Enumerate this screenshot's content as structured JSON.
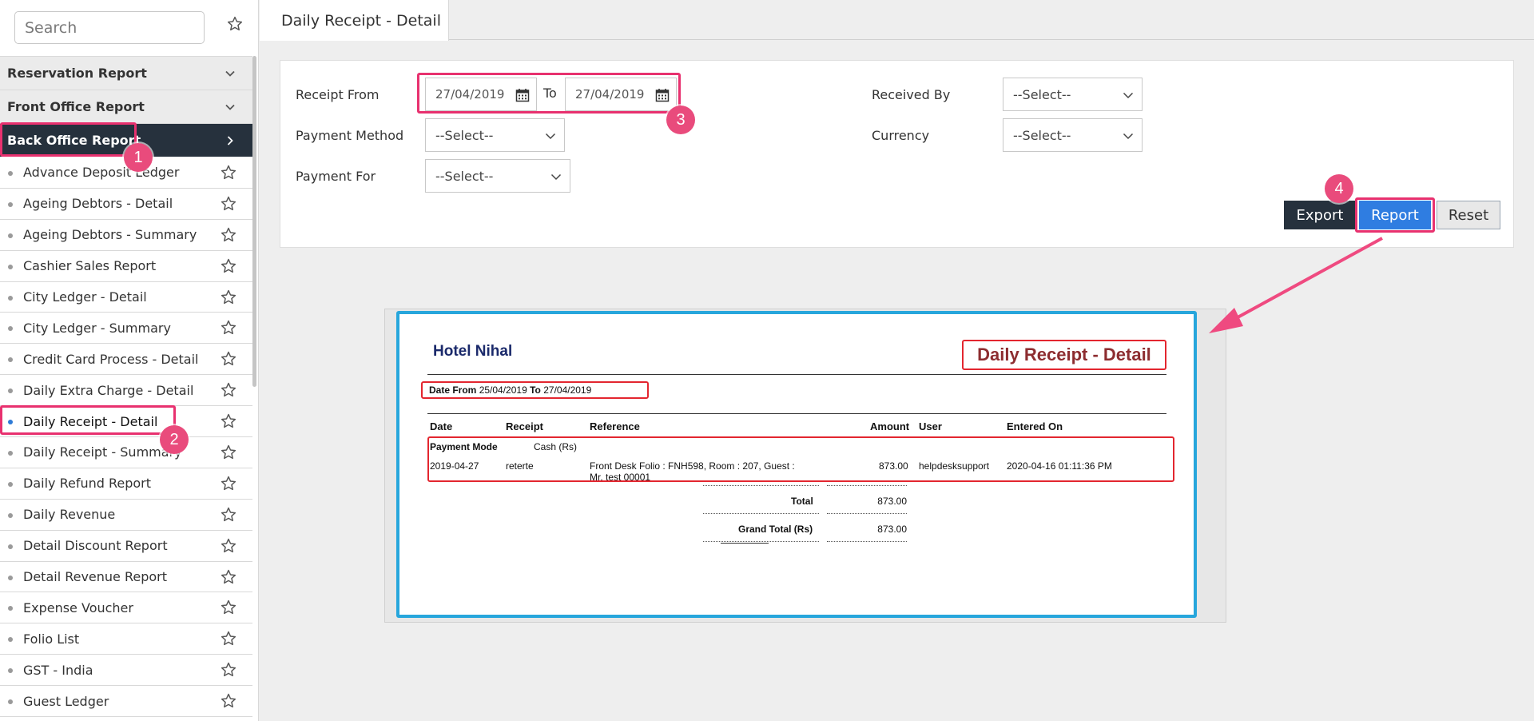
{
  "search": {
    "placeholder": "Search"
  },
  "sidebar": {
    "sections": [
      {
        "label": "Reservation Report"
      },
      {
        "label": "Front Office Report"
      },
      {
        "label": "Back Office Report"
      }
    ],
    "items": [
      {
        "label": "Advance Deposit Ledger"
      },
      {
        "label": "Ageing Debtors - Detail"
      },
      {
        "label": "Ageing Debtors - Summary"
      },
      {
        "label": "Cashier Sales Report"
      },
      {
        "label": "City Ledger - Detail"
      },
      {
        "label": "City Ledger - Summary"
      },
      {
        "label": "Credit Card Process - Detail"
      },
      {
        "label": "Daily Extra Charge - Detail"
      },
      {
        "label": "Daily Receipt - Detail"
      },
      {
        "label": "Daily Receipt - Summary"
      },
      {
        "label": "Daily Refund Report"
      },
      {
        "label": "Daily Revenue"
      },
      {
        "label": "Detail Discount Report"
      },
      {
        "label": "Detail Revenue Report"
      },
      {
        "label": "Expense Voucher"
      },
      {
        "label": "Folio List"
      },
      {
        "label": "GST - India"
      },
      {
        "label": "Guest Ledger"
      }
    ]
  },
  "header": {
    "tab_title": "Daily Receipt - Detail"
  },
  "filters": {
    "receipt_from_label": "Receipt From",
    "date_from": "27/04/2019",
    "to_label": "To",
    "date_to": "27/04/2019",
    "payment_method_label": "Payment Method",
    "payment_method_value": "--Select--",
    "payment_for_label": "Payment For",
    "payment_for_value": "--Select--",
    "received_by_label": "Received By",
    "received_by_value": "--Select--",
    "currency_label": "Currency",
    "currency_value": "--Select--"
  },
  "buttons": {
    "export": "Export",
    "report": "Report",
    "reset": "Reset"
  },
  "badges": [
    "1",
    "2",
    "3",
    "4"
  ],
  "report": {
    "hotel_name": "Hotel Nihal",
    "title": "Daily Receipt - Detail",
    "date_from_label": "Date From",
    "date_from": "25/04/2019",
    "to_label": "To",
    "date_to": "27/04/2019",
    "columns": [
      "Date",
      "Receipt",
      "Reference",
      "Amount",
      "User",
      "Entered On"
    ],
    "payment_mode_label": "Payment Mode",
    "payment_mode_value": "Cash (Rs)",
    "row": {
      "date": "2019-04-27",
      "receipt": "reterte",
      "reference_line1": "Front Desk Folio : FNH598, Room : 207, Guest :",
      "reference_line2": "Mr. test 00001",
      "amount": "873.00",
      "user": "helpdesksupport",
      "entered_on": "2020-04-16 01:11:36 PM"
    },
    "total_label": "Total",
    "total_value": "873.00",
    "grand_total_label": "Grand Total (Rs)",
    "grand_total_value": "873.00"
  },
  "colors": {
    "sidebar_active": "#26313d",
    "report_button": "#2f7de1",
    "annotation": "#e8316f",
    "report_frame": "#27a6dc"
  }
}
